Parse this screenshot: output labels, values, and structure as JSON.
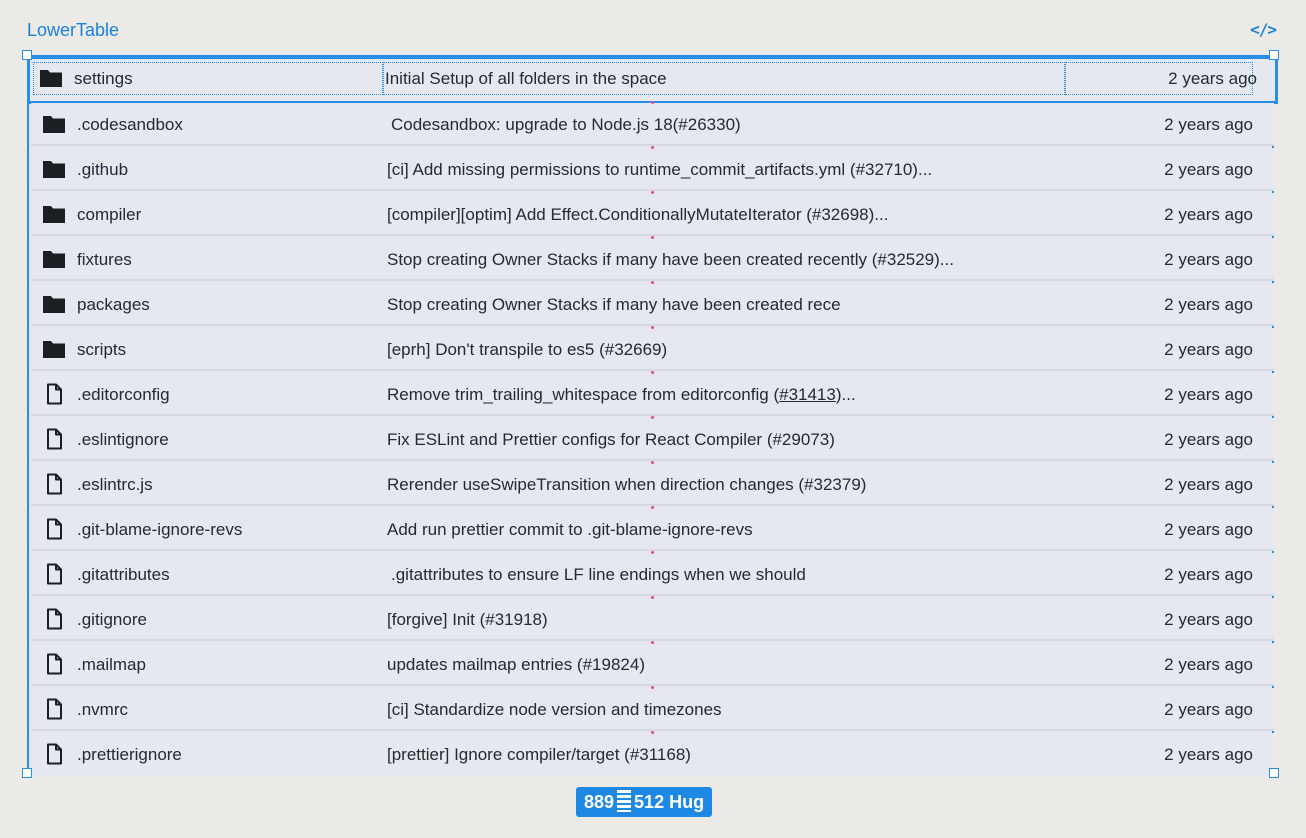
{
  "frame": {
    "title": "LowerTable",
    "code_icon": "code-brackets-icon"
  },
  "rows": [
    {
      "type": "folder",
      "name": "settings",
      "message": "Initial Setup of all folders in the space",
      "date": "2 years ago"
    },
    {
      "type": "folder",
      "name": ".codesandbox",
      "message": "Codesandbox: upgrade to Node.js 18(#26330)",
      "date": "2 years ago"
    },
    {
      "type": "folder",
      "name": ".github",
      "message": "[ci] Add missing permissions to runtime_commit_artifacts.yml (#32710)...",
      "date": "2 years ago"
    },
    {
      "type": "folder",
      "name": "compiler",
      "message": "[compiler][optim] Add Effect.ConditionallyMutateIterator (#32698)...",
      "date": "2 years ago"
    },
    {
      "type": "folder",
      "name": "fixtures",
      "message": "Stop creating Owner Stacks if many have been created recently (#32529)...",
      "date": "2 years ago"
    },
    {
      "type": "folder",
      "name": "packages",
      "message": "Stop creating Owner Stacks if many have been created rece",
      "date": "2 years ago"
    },
    {
      "type": "folder",
      "name": "scripts",
      "message": "[eprh] Don't transpile to es5 (#32669)",
      "date": "2 years ago"
    },
    {
      "type": "file",
      "name": ".editorconfig",
      "message_pre": "Remove trim_trailing_whitespace from editorconfig (",
      "message_link": "#31413",
      "message_post": ")...",
      "date": "2 years ago"
    },
    {
      "type": "file",
      "name": ".eslintignore",
      "message": "Fix ESLint and Prettier configs for React Compiler (#29073)",
      "date": "2 years ago"
    },
    {
      "type": "file",
      "name": ".eslintrc.js",
      "message": "Rerender useSwipeTransition when direction changes (#32379)",
      "date": "2 years ago"
    },
    {
      "type": "file",
      "name": ".git-blame-ignore-revs",
      "message": "Add run prettier commit to .git-blame-ignore-revs",
      "date": "2 years ago"
    },
    {
      "type": "file",
      "name": ".gitattributes",
      "message": ".gitattributes to ensure LF line endings when we should",
      "date": "2 years ago"
    },
    {
      "type": "file",
      "name": ".gitignore",
      "message": "[forgive] Init (#31918)",
      "date": "2 years ago"
    },
    {
      "type": "file",
      "name": ".mailmap",
      "message": "updates mailmap entries (#19824)",
      "date": "2 years ago"
    },
    {
      "type": "file",
      "name": ".nvmrc",
      "message": "[ci] Standardize node version and timezones",
      "date": "2 years ago"
    },
    {
      "type": "file",
      "name": ".prettierignore",
      "message": "[prettier] Ignore compiler/target (#31168)",
      "date": "2 years ago"
    }
  ],
  "size_badge": {
    "width": "889",
    "height": "512",
    "mode": "Hug"
  },
  "colors": {
    "accent": "#2a8ee6",
    "background": "#ebeae6",
    "row_bg": "#e5e8ee",
    "text": "#26292e",
    "spacer_dot": "#e54a8a"
  }
}
